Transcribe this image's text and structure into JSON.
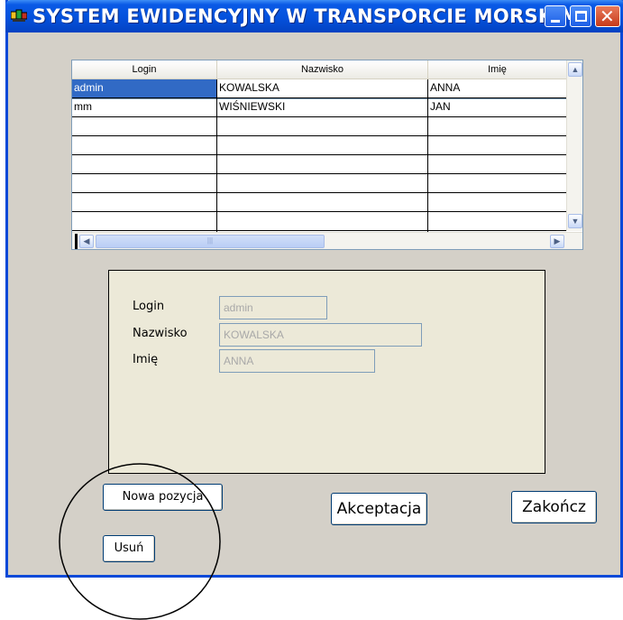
{
  "window": {
    "title": "SYSTEM  EWIDENCYJNY  W  TRANSPORCIE  MORSKIM",
    "icons": {
      "app": "app-icon",
      "minimize": "minimize-icon",
      "maximize": "maximize-icon",
      "close": "close-icon"
    },
    "accent_color": "#0a49d8"
  },
  "grid": {
    "columns": [
      "Login",
      "Nazwisko",
      "Imię"
    ],
    "rows": [
      [
        "admin",
        "KOWALSKA",
        "ANNA"
      ],
      [
        "mm",
        "WIŚNIEWSKI",
        "JAN"
      ],
      [
        "",
        "",
        ""
      ],
      [
        "",
        "",
        ""
      ],
      [
        "",
        "",
        ""
      ],
      [
        "",
        "",
        ""
      ],
      [
        "",
        "",
        ""
      ],
      [
        "",
        "",
        ""
      ],
      [
        "",
        "",
        ""
      ],
      [
        "",
        "",
        ""
      ]
    ],
    "selected_row": 0,
    "selection_color": "#316ac5"
  },
  "form": {
    "login": {
      "label": "Login",
      "value": "admin"
    },
    "nazwisko": {
      "label": "Nazwisko",
      "value": "KOWALSKA"
    },
    "imie": {
      "label": "Imię",
      "value": "ANNA"
    }
  },
  "buttons": {
    "new": "Nowa pozycja",
    "delete": "Usuń",
    "accept": "Akceptacja",
    "close": "Zakończ"
  }
}
